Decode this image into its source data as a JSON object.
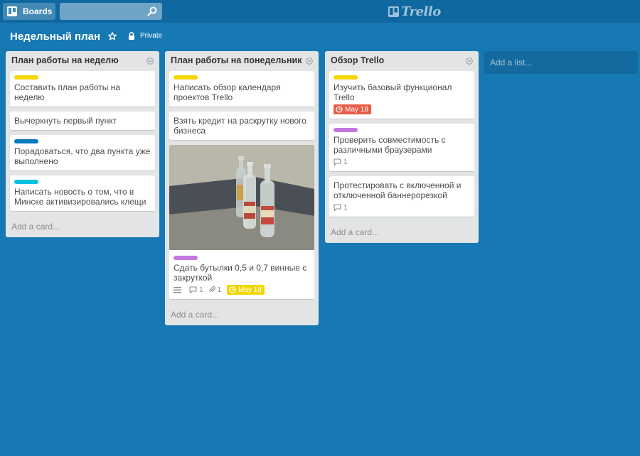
{
  "header": {
    "boards_label": "Boards",
    "search_value": "",
    "logo_text": "Trello"
  },
  "board": {
    "title": "Недельный план",
    "visibility": "Private"
  },
  "colors": {
    "background": "#1779b4",
    "header": "#0f68a0",
    "label_yellow": "#f2d600",
    "label_blue": "#0079bf",
    "label_cyan": "#00c2e0",
    "label_purple": "#c377e0",
    "due_red": "#eb5a46",
    "due_yellow": "#f2d600"
  },
  "lists": [
    {
      "title": "План работы на неделю",
      "add_card": "Add a card...",
      "cards": [
        {
          "label": "yellow",
          "title": "Составить план работы на неделю"
        },
        {
          "title": "Вычеркнуть первый пункт"
        },
        {
          "label": "blue",
          "title": "Порадоваться, что два пункта уже выполнено"
        },
        {
          "label": "cyan",
          "title": "Написать новость о том, что в Минске активизировались клещи"
        }
      ]
    },
    {
      "title": "План работы на понедельник",
      "add_card": "Add a card...",
      "cards": [
        {
          "label": "yellow",
          "title": "Написать обзор календаря проектов Trello"
        },
        {
          "title": "Взять кредит на раскрутку нового бизнеса"
        },
        {
          "cover": "photo-bottles",
          "label": "purple",
          "title": "Сдать бутылки 0,5 и 0,7 винные с закруткой",
          "comments": "1",
          "attachments": "1",
          "due": "May 18"
        }
      ]
    },
    {
      "title": "Обзор Trello",
      "add_card": "Add a card...",
      "cards": [
        {
          "label": "yellow",
          "title": "Изучить базовый функционал Trello",
          "due": "May 18"
        },
        {
          "label": "purple",
          "title": "Проверить совместимость с различными браузерами",
          "comments": "1"
        },
        {
          "title": "Протестировать с включенной и отключенной баннерорезкой",
          "comments": "1"
        }
      ]
    }
  ],
  "add_list": "Add a list..."
}
